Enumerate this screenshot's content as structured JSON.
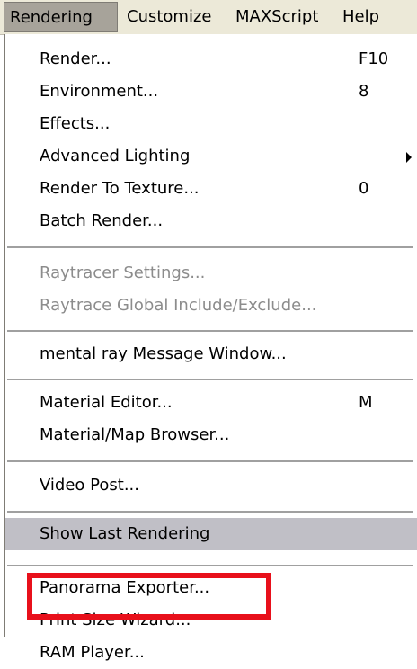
{
  "menubar": {
    "items": [
      {
        "label": "Rendering",
        "active": true
      },
      {
        "label": "Customize"
      },
      {
        "label": "MAXScript"
      },
      {
        "label": "Help"
      }
    ]
  },
  "menu": {
    "items": [
      {
        "label": "Render...",
        "shortcut": "F10"
      },
      {
        "label": "Environment...",
        "shortcut": "8"
      },
      {
        "label": "Effects..."
      },
      {
        "label": "Advanced Lighting",
        "submenu": true
      },
      {
        "label": "Render To Texture...",
        "shortcut": "0"
      },
      {
        "label": "Batch Render..."
      },
      {
        "label": "Raytracer Settings...",
        "disabled": true
      },
      {
        "label": "Raytrace Global Include/Exclude...",
        "disabled": true
      },
      {
        "label": "mental ray Message Window..."
      },
      {
        "label": "Material Editor...",
        "shortcut": "M"
      },
      {
        "label": "Material/Map Browser..."
      },
      {
        "label": "Video Post..."
      },
      {
        "label": "Show Last Rendering",
        "highlighted": true
      },
      {
        "label": "Panorama Exporter..."
      },
      {
        "label": "Print Size Wizard..."
      },
      {
        "label": "RAM Player..."
      }
    ]
  },
  "annotation": {
    "highlight_color": "#e8101b",
    "target": "Show Last Rendering"
  }
}
